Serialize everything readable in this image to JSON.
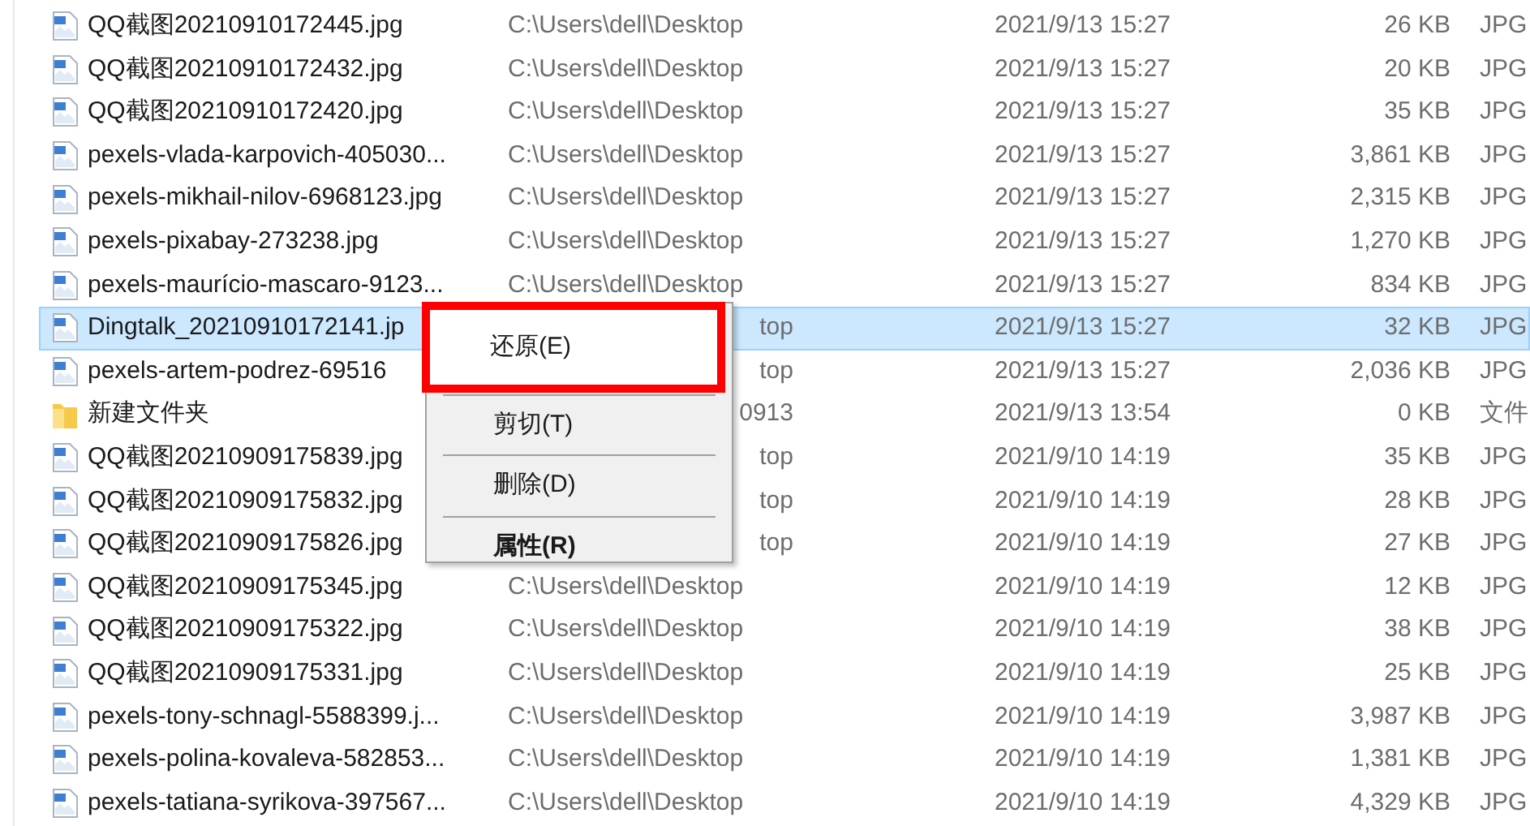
{
  "files": [
    {
      "kind": "image",
      "name": "QQ截图20210910172445.jpg",
      "location": "C:\\Users\\dell\\Desktop",
      "location_clipped": false,
      "date": "2021/9/13 15:27",
      "size": "26 KB",
      "type": "JPG",
      "selected": false
    },
    {
      "kind": "image",
      "name": "QQ截图20210910172432.jpg",
      "location": "C:\\Users\\dell\\Desktop",
      "location_clipped": false,
      "date": "2021/9/13 15:27",
      "size": "20 KB",
      "type": "JPG",
      "selected": false
    },
    {
      "kind": "image",
      "name": "QQ截图20210910172420.jpg",
      "location": "C:\\Users\\dell\\Desktop",
      "location_clipped": false,
      "date": "2021/9/13 15:27",
      "size": "35 KB",
      "type": "JPG",
      "selected": false
    },
    {
      "kind": "image",
      "name": "pexels-vlada-karpovich-405030...",
      "location": "C:\\Users\\dell\\Desktop",
      "location_clipped": false,
      "date": "2021/9/13 15:27",
      "size": "3,861 KB",
      "type": "JPG",
      "selected": false
    },
    {
      "kind": "image",
      "name": "pexels-mikhail-nilov-6968123.jpg",
      "location": "C:\\Users\\dell\\Desktop",
      "location_clipped": false,
      "date": "2021/9/13 15:27",
      "size": "2,315 KB",
      "type": "JPG",
      "selected": false
    },
    {
      "kind": "image",
      "name": "pexels-pixabay-273238.jpg",
      "location": "C:\\Users\\dell\\Desktop",
      "location_clipped": false,
      "date": "2021/9/13 15:27",
      "size": "1,270 KB",
      "type": "JPG",
      "selected": false
    },
    {
      "kind": "image",
      "name": "pexels-maurício-mascaro-9123...",
      "location": "C:\\Users\\dell\\Desktop",
      "location_clipped": false,
      "date": "2021/9/13 15:27",
      "size": "834 KB",
      "type": "JPG",
      "selected": false
    },
    {
      "kind": "image",
      "name": "Dingtalk_20210910172141.jp",
      "location": "top",
      "location_clipped": true,
      "date": "2021/9/13 15:27",
      "size": "32 KB",
      "type": "JPG",
      "selected": true
    },
    {
      "kind": "image",
      "name": "pexels-artem-podrez-69516",
      "location": "top",
      "location_clipped": true,
      "date": "2021/9/13 15:27",
      "size": "2,036 KB",
      "type": "JPG",
      "selected": false
    },
    {
      "kind": "folder",
      "name": "新建文件夹",
      "location": "0913",
      "location_clipped": true,
      "date": "2021/9/13 13:54",
      "size": "0 KB",
      "type": "文件",
      "selected": false
    },
    {
      "kind": "image",
      "name": "QQ截图20210909175839.jpg",
      "location": "top",
      "location_clipped": true,
      "date": "2021/9/10 14:19",
      "size": "35 KB",
      "type": "JPG",
      "selected": false
    },
    {
      "kind": "image",
      "name": "QQ截图20210909175832.jpg",
      "location": "top",
      "location_clipped": true,
      "date": "2021/9/10 14:19",
      "size": "28 KB",
      "type": "JPG",
      "selected": false
    },
    {
      "kind": "image",
      "name": "QQ截图20210909175826.jpg",
      "location": "top",
      "location_clipped": true,
      "date": "2021/9/10 14:19",
      "size": "27 KB",
      "type": "JPG",
      "selected": false
    },
    {
      "kind": "image",
      "name": "QQ截图20210909175345.jpg",
      "location": "C:\\Users\\dell\\Desktop",
      "location_clipped": false,
      "date": "2021/9/10 14:19",
      "size": "12 KB",
      "type": "JPG",
      "selected": false
    },
    {
      "kind": "image",
      "name": "QQ截图20210909175322.jpg",
      "location": "C:\\Users\\dell\\Desktop",
      "location_clipped": false,
      "date": "2021/9/10 14:19",
      "size": "38 KB",
      "type": "JPG",
      "selected": false
    },
    {
      "kind": "image",
      "name": "QQ截图20210909175331.jpg",
      "location": "C:\\Users\\dell\\Desktop",
      "location_clipped": false,
      "date": "2021/9/10 14:19",
      "size": "25 KB",
      "type": "JPG",
      "selected": false
    },
    {
      "kind": "image",
      "name": "pexels-tony-schnagl-5588399.j...",
      "location": "C:\\Users\\dell\\Desktop",
      "location_clipped": false,
      "date": "2021/9/10 14:19",
      "size": "3,987 KB",
      "type": "JPG",
      "selected": false
    },
    {
      "kind": "image",
      "name": "pexels-polina-kovaleva-582853...",
      "location": "C:\\Users\\dell\\Desktop",
      "location_clipped": false,
      "date": "2021/9/10 14:19",
      "size": "1,381 KB",
      "type": "JPG",
      "selected": false
    },
    {
      "kind": "image",
      "name": "pexels-tatiana-syrikova-397567...",
      "location": "C:\\Users\\dell\\Desktop",
      "location_clipped": false,
      "date": "2021/9/10 14:19",
      "size": "4,329 KB",
      "type": "JPG",
      "selected": false
    }
  ],
  "context_menu": [
    {
      "kind": "item",
      "label": "还原(E)",
      "bold": false,
      "highlighted": true
    },
    {
      "kind": "separator"
    },
    {
      "kind": "item",
      "label": "剪切(T)",
      "bold": false,
      "highlighted": false
    },
    {
      "kind": "separator"
    },
    {
      "kind": "item",
      "label": "删除(D)",
      "bold": false,
      "highlighted": false
    },
    {
      "kind": "separator"
    },
    {
      "kind": "item",
      "label": "属性(R)",
      "bold": true,
      "highlighted": false
    }
  ]
}
